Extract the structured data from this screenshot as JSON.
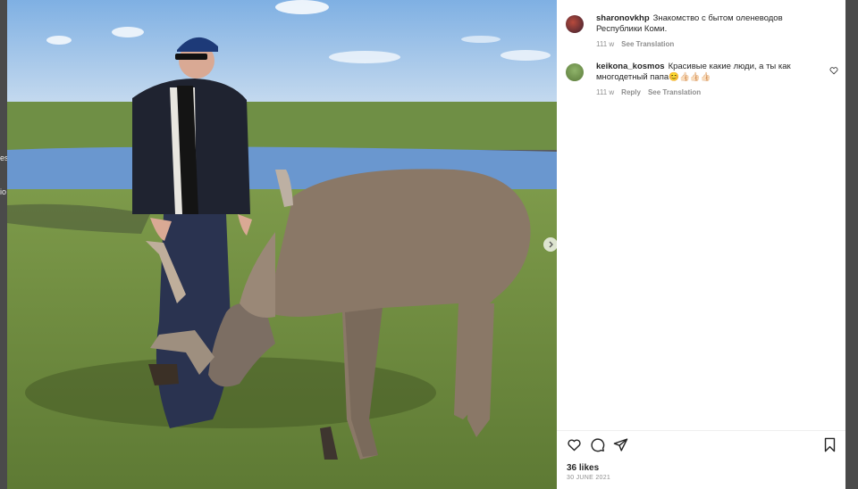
{
  "post": {
    "author": "sharonovkhp",
    "caption": "Знакомство с бытом оленеводов Республики Коми.",
    "age": "111 w",
    "see_translation": "See Translation"
  },
  "comments": [
    {
      "username": "keikona_kosmos",
      "text": "Красивые какие люди, а ты как многодетный папа😊👍🏻👍🏻👍🏻",
      "age": "111 w",
      "reply_label": "Reply",
      "translation_label": "See Translation"
    }
  ],
  "likes": "36 likes",
  "date": "30 JUNE 2021",
  "left_peek": [
    "es",
    "io"
  ],
  "colors": {
    "sky": "#8fb7e0",
    "grass": "#6d8a3c",
    "water": "#6f9ad0",
    "panel": "#ffffff"
  },
  "icons": [
    "heart-icon",
    "comment-icon",
    "share-icon",
    "bookmark-icon",
    "chevron-right-icon"
  ]
}
